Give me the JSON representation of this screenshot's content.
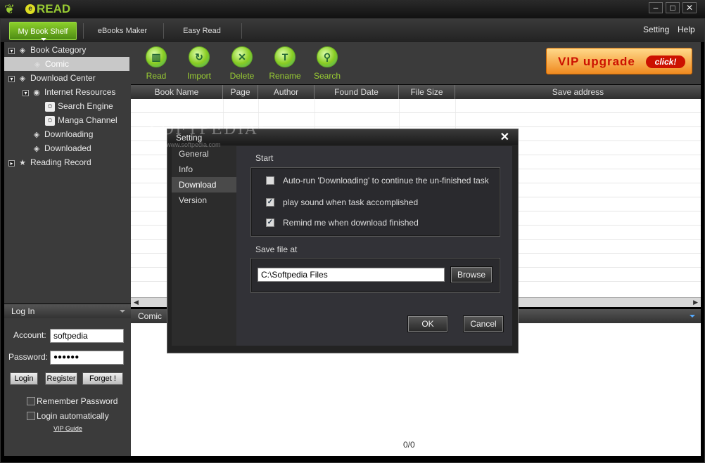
{
  "app": {
    "logo_text": "READ",
    "logo_letter": "e"
  },
  "window": {
    "min": "–",
    "max": "□",
    "close": "✕"
  },
  "tabs": [
    {
      "label": "My Book Shelf"
    },
    {
      "label": "eBooks Maker"
    },
    {
      "label": "Easy Read"
    }
  ],
  "top_links": {
    "setting": "Setting",
    "help": "Help"
  },
  "tree": {
    "book_category": "Book Category",
    "comic": "Comic",
    "download_center": "Download Center",
    "internet_resources": "Internet Resources",
    "search_engine": "Search Engine",
    "manga_channel": "Manga Channel",
    "downloading": "Downloading",
    "downloaded": "Downloaded",
    "reading_record": "Reading Record"
  },
  "login": {
    "header": "Log In",
    "account_label": "Account:",
    "account_value": "softpedia",
    "password_label": "Password:",
    "password_value": "●●●●●●",
    "login_btn": "Login",
    "register_btn": "Register",
    "forget_btn": "Forget !",
    "remember": "Remember Password",
    "auto_login": "Login automatically",
    "vip_guide": "VIP Guide"
  },
  "toolbar": [
    {
      "label": "Read",
      "icon": "book-icon"
    },
    {
      "label": "Import",
      "icon": "import-icon"
    },
    {
      "label": "Delete",
      "icon": "delete-icon"
    },
    {
      "label": "Rename",
      "icon": "rename-icon"
    },
    {
      "label": "Search",
      "icon": "search-icon"
    }
  ],
  "vip": {
    "text": "VIP upgrade",
    "click": "click!"
  },
  "table": {
    "columns": [
      "Book Name",
      "Page",
      "Author",
      "Found Date",
      "File Size",
      "Save address"
    ]
  },
  "lower_panel": {
    "title": "Comic",
    "pager": "0/0"
  },
  "watermark": {
    "text": "SOFTPEDIA",
    "mark": "®",
    "url": "www.softpedia.com"
  },
  "dialog": {
    "title": "Setting",
    "close": "✕",
    "nav": [
      "General",
      "Info",
      "Download",
      "Version"
    ],
    "start_label": "Start",
    "options": [
      {
        "label": "Auto-run 'Downloading' to continue the un-finished task",
        "checked": false
      },
      {
        "label": "play sound when task accomplished",
        "checked": true
      },
      {
        "label": "Remind me when download finished",
        "checked": true
      }
    ],
    "save_label": "Save file at",
    "save_path": "C:\\Softpedia Files",
    "browse": "Browse",
    "ok": "OK",
    "cancel": "Cancel"
  },
  "colors": {
    "accent_green": "#8bcf2a",
    "vip_red": "#cc1100",
    "dark_bg": "#3b3b3b"
  }
}
